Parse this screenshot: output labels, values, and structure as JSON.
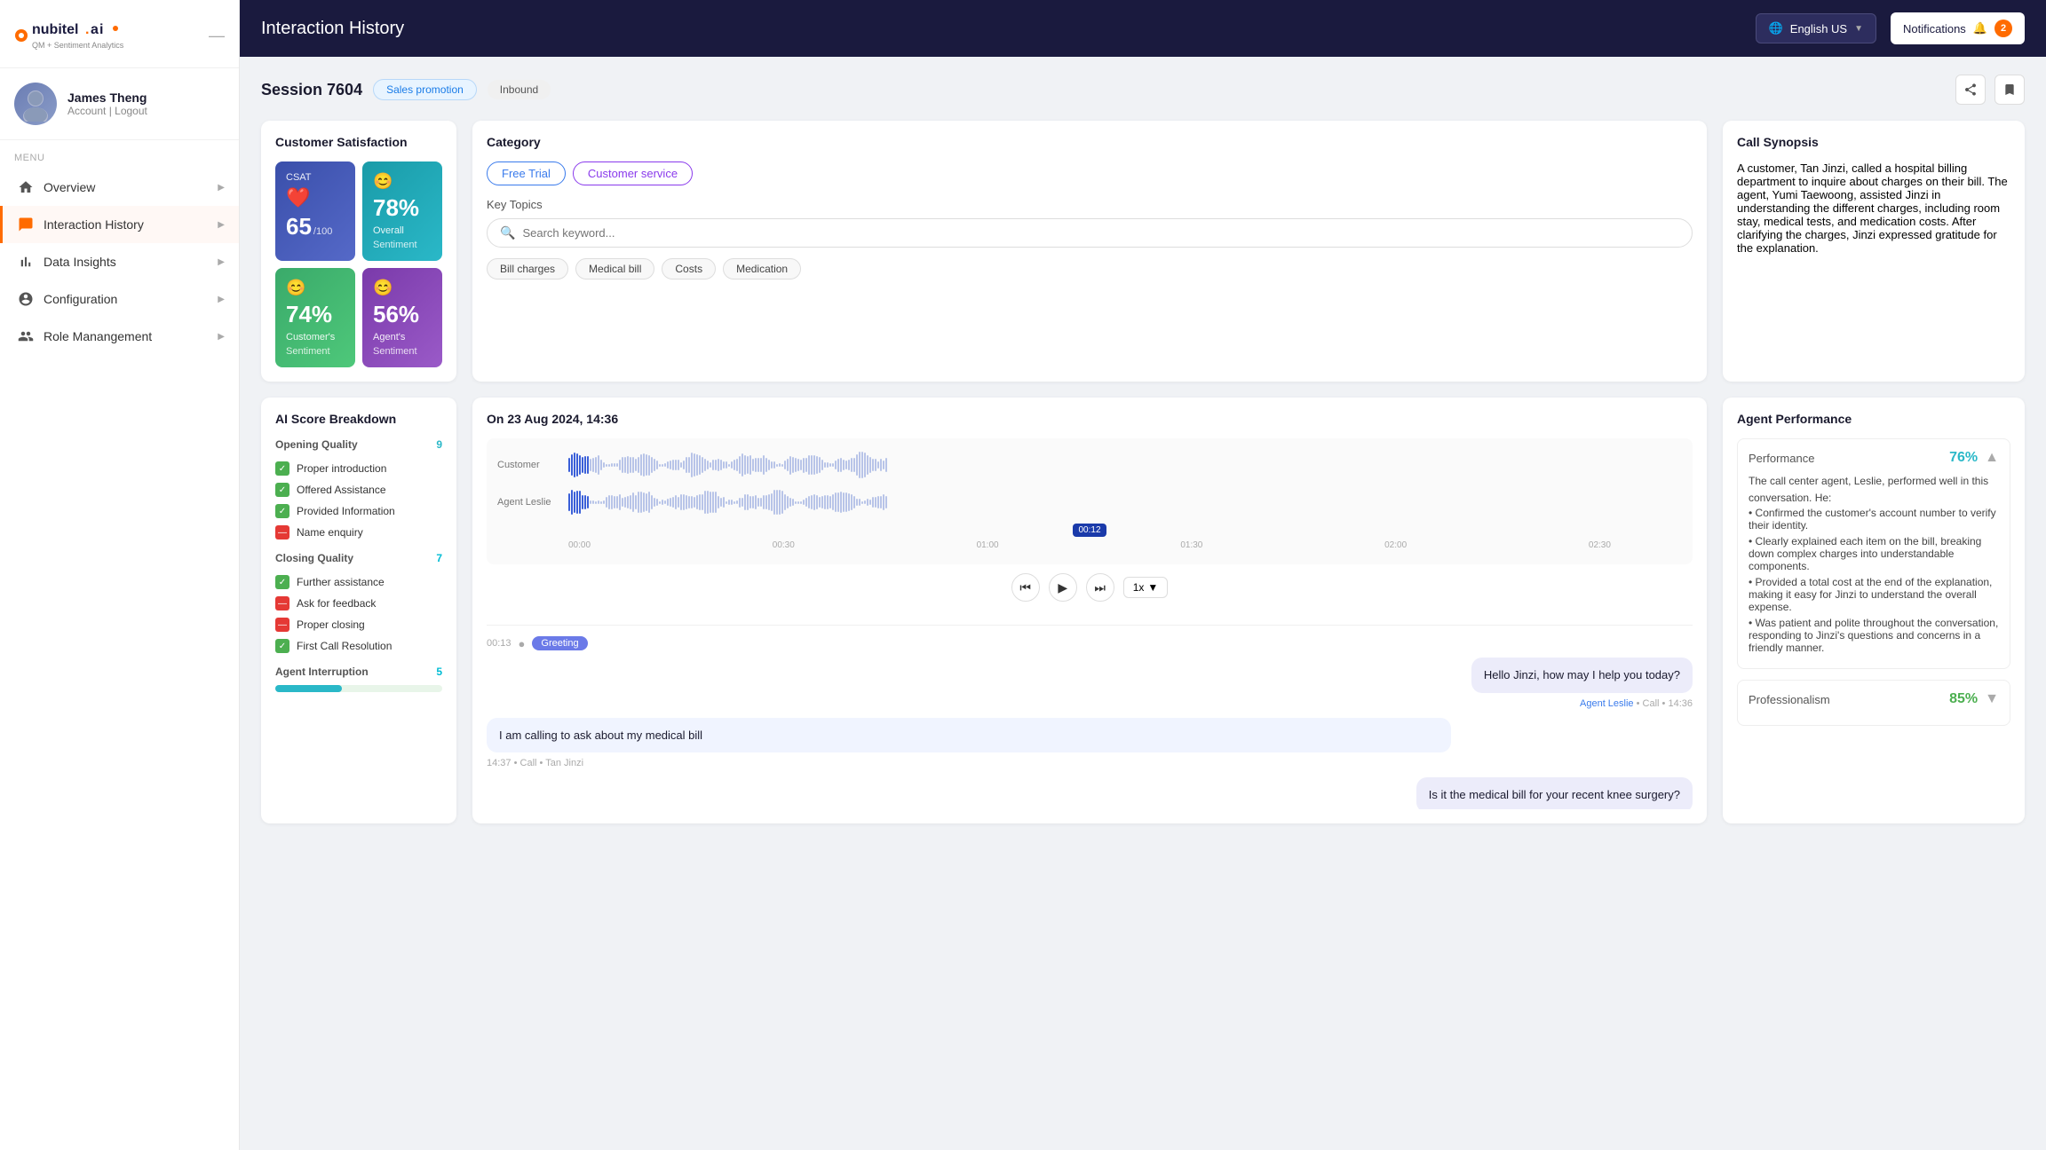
{
  "sidebar": {
    "logo_text": "nubitel.ai",
    "logo_sub": "QM + Sentiment Analytics",
    "minimize_label": "—",
    "user": {
      "name": "James Theng",
      "account_link": "Account",
      "logout_link": "Logout"
    },
    "menu_label": "Menu",
    "nav_items": [
      {
        "id": "overview",
        "label": "Overview",
        "icon": "home",
        "active": false
      },
      {
        "id": "interaction-history",
        "label": "Interaction History",
        "icon": "chat",
        "active": true
      },
      {
        "id": "data-insights",
        "label": "Data Insights",
        "icon": "bar-chart",
        "active": false
      },
      {
        "id": "configuration",
        "label": "Configuration",
        "icon": "user-settings",
        "active": false
      },
      {
        "id": "role-management",
        "label": "Role Manangement",
        "icon": "user-group",
        "active": false
      }
    ]
  },
  "topbar": {
    "title": "Interaction History",
    "lang": "English US",
    "notifications_label": "Notifications",
    "notif_count": "2"
  },
  "session": {
    "id": "Session 7604",
    "tag_sales": "Sales promotion",
    "tag_inbound": "Inbound",
    "date_time": "On 23 Aug 2024, 14:36"
  },
  "customer_satisfaction": {
    "title": "Customer Satisfaction",
    "csat_label": "CSAT",
    "csat_value": "65",
    "csat_sub": "/100",
    "overall_pct": "78%",
    "overall_label": "Overall",
    "overall_sub": "Sentiment",
    "customer_pct": "74%",
    "customer_label": "Customer's",
    "customer_sub": "Sentiment",
    "agent_pct": "56%",
    "agent_label": "Agent's",
    "agent_sub": "Sentiment"
  },
  "category": {
    "title": "Category",
    "tags": [
      "Free Trial",
      "Customer service"
    ],
    "key_topics_label": "Key Topics",
    "search_placeholder": "Search keyword...",
    "topics": [
      "Bill charges",
      "Medical bill",
      "Costs",
      "Medication"
    ]
  },
  "synopsis": {
    "title": "Call Synopsis",
    "text": "A customer, Tan Jinzi, called a hospital billing department to inquire about charges on their bill. The agent, Yumi Taewoong, assisted Jinzi in understanding the different charges, including room stay, medical tests, and medication costs. After clarifying the charges, Jinzi expressed gratitude for the explanation."
  },
  "ai_score": {
    "title": "AI Score Breakdown",
    "opening_quality": {
      "label": "Opening Quality",
      "score": "9",
      "items": [
        {
          "label": "Proper introduction",
          "checked": true
        },
        {
          "label": "Offered Assistance",
          "checked": true
        },
        {
          "label": "Provided Information",
          "checked": true
        },
        {
          "label": "Name enquiry",
          "checked": false
        }
      ]
    },
    "closing_quality": {
      "label": "Closing Quality",
      "score": "7",
      "items": [
        {
          "label": "Further assistance",
          "checked": true
        },
        {
          "label": "Ask for feedback",
          "checked": false
        },
        {
          "label": "Proper closing",
          "checked": false
        },
        {
          "label": "First Call Resolution",
          "checked": true
        }
      ]
    },
    "agent_interruption": {
      "label": "Agent Interruption",
      "score": "5"
    }
  },
  "audio": {
    "customer_label": "Customer",
    "agent_label": "Agent Leslie",
    "time_marker": "00:12",
    "timeline": [
      "00:00",
      "00:30",
      "01:00",
      "01:30",
      "02:00",
      "02:30"
    ],
    "speed_label": "1x",
    "transcript": [
      {
        "time": "00:13",
        "tag": "Greeting",
        "bubble": "Hello Jinzi, how may I help you today?",
        "speaker": "Agent Leslie",
        "channel": "Call",
        "timestamp": "14:36",
        "is_agent": true
      },
      {
        "time": "14:37",
        "tag": "",
        "bubble": "I am calling to ask about my medical bill",
        "speaker": "Tan Jinzi",
        "channel": "Call",
        "timestamp": "14:37",
        "is_agent": false
      },
      {
        "time": "",
        "tag": "",
        "bubble": "Is it the medical bill for your recent knee surgery?",
        "speaker": "",
        "channel": "",
        "timestamp": "",
        "is_agent": true
      }
    ]
  },
  "agent_performance": {
    "title": "Agent Performance",
    "performance_label": "Performance",
    "performance_pct": "76%",
    "performance_text": "The call center agent, Leslie, performed well in this conversation. He:",
    "performance_bullets": [
      "Confirmed the customer's account number to verify their identity.",
      "Clearly explained each item on the bill, breaking down complex charges into understandable components.",
      "Provided a total cost at the end of the explanation, making it easy for Jinzi to understand the overall expense.",
      "Was patient and polite throughout the conversation, responding to Jinzi's questions and concerns in a friendly manner."
    ],
    "professionalism_label": "Professionalism",
    "professionalism_pct": "85%"
  }
}
